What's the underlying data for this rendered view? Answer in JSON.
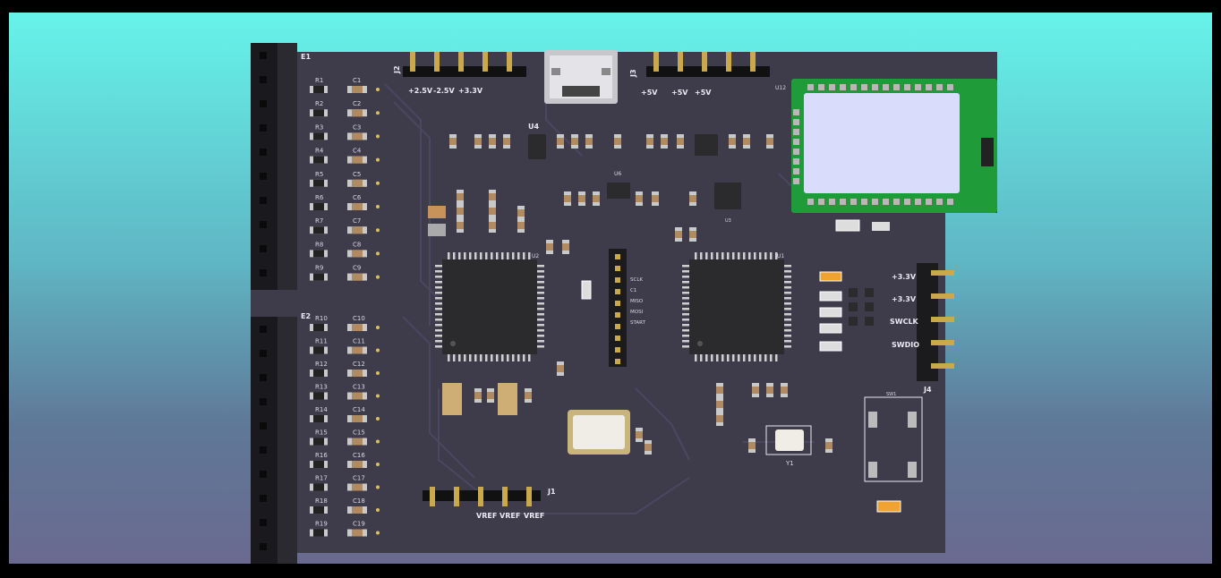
{
  "colors": {
    "pcb": "#3e3b4b",
    "silkscreen": "#e9e9f2",
    "ble_module": "#1f9b3a",
    "background_top": "#66f3ea",
    "background_bottom": "#6a6a90"
  },
  "connectors": {
    "e1": "E1",
    "e2": "E2",
    "j1": "J1",
    "j2": "J2",
    "j3": "J3",
    "j4": "J4",
    "j2_labels": [
      "+2.5V",
      "-2.5V",
      "+3.3V"
    ],
    "j3_labels": [
      "+5V",
      "+5V",
      "+5V"
    ],
    "j1_labels": [
      "VREF",
      "VREF",
      "VREF"
    ],
    "j4_labels": [
      "+3.3V",
      "+3.3V",
      "SWCLK",
      "SWDIO"
    ],
    "center_header_labels": [
      "SCLK",
      "C1",
      "MISO",
      "MOSI",
      "START"
    ]
  },
  "resistors": [
    "R1",
    "R2",
    "R3",
    "R4",
    "R5",
    "R6",
    "R7",
    "R8",
    "R9",
    "R10",
    "R11",
    "R12",
    "R13",
    "R14",
    "R15",
    "R16",
    "R17",
    "R18",
    "R19"
  ],
  "capacitors": [
    "C1",
    "C2",
    "C3",
    "C4",
    "C5",
    "C6",
    "C7",
    "C8",
    "C9",
    "C10",
    "C11",
    "C12",
    "C13",
    "C14",
    "C15",
    "C16",
    "C17",
    "C18",
    "C19"
  ],
  "components": {
    "u1": "U1",
    "u2": "U2",
    "u3": "U3",
    "u4": "U4",
    "u6": "U6",
    "u12": "U12",
    "y1": "Y1",
    "sw1": "SW1"
  }
}
